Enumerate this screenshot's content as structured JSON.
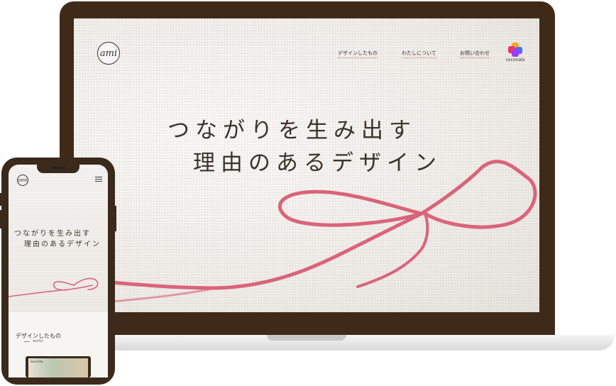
{
  "desktop": {
    "logo_text": "ami",
    "nav": [
      {
        "label": "デザインしたもの"
      },
      {
        "label": "わたしについて"
      },
      {
        "label": "お問い合わせ"
      }
    ],
    "coconala_label": "coconala",
    "hero_line1": "つながりを生み出す",
    "hero_line2": "理由のあるデザイン"
  },
  "mobile": {
    "logo_text": "ami",
    "hero_line1": "つながりを生み出す",
    "hero_line2": "理由のあるデザイン",
    "section_title": "デザインしたもの",
    "section_sub": "works",
    "thumb_text": "Sonoriha"
  },
  "colors": {
    "frame": "#3f2a19",
    "thread": "#d9647a",
    "text": "#3c332c"
  }
}
